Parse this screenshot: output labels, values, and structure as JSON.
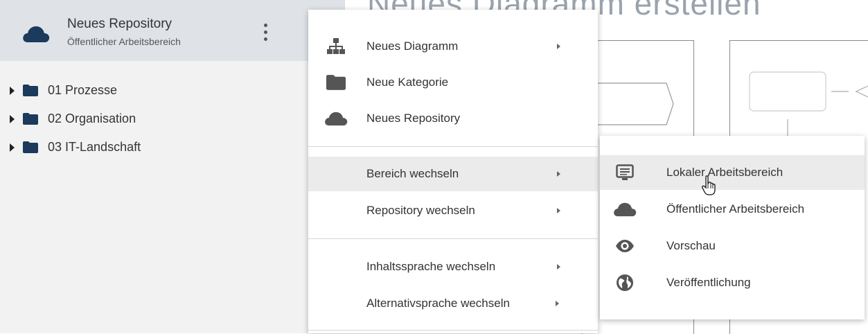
{
  "sidebar": {
    "repo_title": "Neues Repository",
    "repo_subtitle": "Öffentlicher Arbeitsbereich",
    "tree": [
      {
        "label": "01 Prozesse"
      },
      {
        "label": "02 Organisation"
      },
      {
        "label": "03 IT-Landschaft"
      }
    ]
  },
  "canvas": {
    "title": "Neues Diagramm erstellen"
  },
  "context_menu": {
    "items": [
      {
        "label": "Neues Diagramm",
        "icon": "hierarchy-icon",
        "submenu": true
      },
      {
        "label": "Neue Kategorie",
        "icon": "folder-icon",
        "submenu": false
      },
      {
        "label": "Neues Repository",
        "icon": "cloud-icon",
        "submenu": false
      },
      {
        "label": "Bereich wechseln",
        "icon": "",
        "submenu": true,
        "highlighted": true
      },
      {
        "label": "Repository wechseln",
        "icon": "",
        "submenu": true
      },
      {
        "label": "Inhaltssprache wechseln",
        "icon": "",
        "submenu": true
      },
      {
        "label": "Alternativsprache wechseln",
        "icon": "",
        "submenu": true
      }
    ]
  },
  "submenu": {
    "items": [
      {
        "label": "Lokaler Arbeitsbereich",
        "icon": "list-icon",
        "highlighted": true
      },
      {
        "label": "Öffentlicher Arbeitsbereich",
        "icon": "cloud-icon"
      },
      {
        "label": "Vorschau",
        "icon": "eye-icon"
      },
      {
        "label": "Veröffentlichung",
        "icon": "globe-icon"
      }
    ]
  },
  "colors": {
    "sidebar_bg": "#f2f2f2",
    "header_bg": "#dfe3e8",
    "folder": "#1b3a5c",
    "cloud_brand": "#1b3a5c",
    "icon_gray": "#555555",
    "highlight": "#ebebeb"
  }
}
